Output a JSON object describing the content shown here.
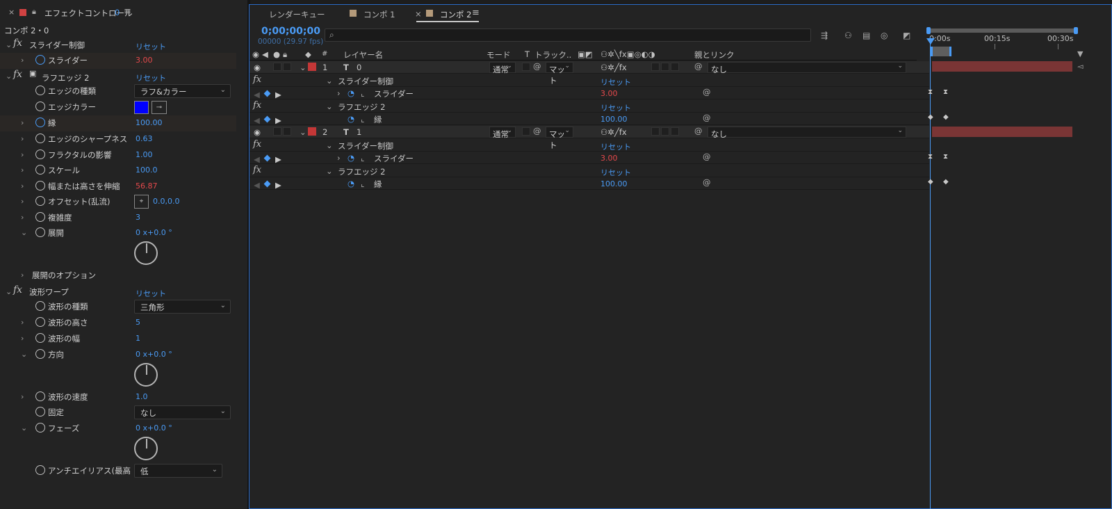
{
  "effect_panel": {
    "close": "×",
    "title": "エフェクトコントロール",
    "title_suffix": "0",
    "menu": "≡",
    "comp_label": "コンポ 2・0",
    "reset": "リセット",
    "slider_control": {
      "name": "スライダー制御",
      "slider_label": "スライダー",
      "slider_value": "3.00"
    },
    "rough_edges": {
      "name": "ラフエッジ 2",
      "edge_type_label": "エッジの種類",
      "edge_type_value": "ラフ&カラー",
      "edge_color_label": "エッジカラー",
      "edge_color": "#0000ff",
      "border_label": "縁",
      "border_value": "100.00",
      "sharpness_label": "エッジのシャープネス",
      "sharpness_value": "0.63",
      "fractal_label": "フラクタルの影響",
      "fractal_value": "1.00",
      "scale_label": "スケール",
      "scale_value": "100.0",
      "stretch_label": "幅または高さを伸縮",
      "stretch_value": "56.87",
      "offset_label": "オフセット(乱流)",
      "offset_value": "0.0,0.0",
      "complexity_label": "複雑度",
      "complexity_value": "3",
      "evolution_label": "展開",
      "evolution_value": "0 x+0.0 °",
      "evolution_options_label": "展開のオプション"
    },
    "wave_warp": {
      "name": "波形ワープ",
      "wave_type_label": "波形の種類",
      "wave_type_value": "三角形",
      "wave_height_label": "波形の高さ",
      "wave_height_value": "5",
      "wave_width_label": "波形の幅",
      "wave_width_value": "1",
      "direction_label": "方向",
      "direction_value": "0 x+0.0 °",
      "wave_speed_label": "波形の速度",
      "wave_speed_value": "1.0",
      "pinning_label": "固定",
      "pinning_value": "なし",
      "phase_label": "フェーズ",
      "phase_value": "0 x+0.0 °",
      "antialias_label": "アンチエイリアス(最高",
      "antialias_value": "低"
    }
  },
  "timeline": {
    "tabs": [
      {
        "label": "レンダーキュー"
      },
      {
        "label": "コンポ 1"
      },
      {
        "label": "コンポ 2"
      }
    ],
    "tab_close": "×",
    "tab_menu": "≡",
    "timecode": "0;00;00;00",
    "frames_fps": "00000 (29.97 fps)",
    "search_placeholder": "",
    "columns": {
      "number": "#",
      "layer_name": "レイヤー名",
      "mode": "モード",
      "t": "T",
      "track_matte": "トラック..",
      "parent_link": "親とリンク"
    },
    "reset": "リセット",
    "layers": [
      {
        "index": "1",
        "name": "0",
        "mode": "通常",
        "matte": "マット",
        "parent": "なし",
        "effects": [
          {
            "name": "スライダー制御",
            "prop": "スライダー",
            "value": "3.00"
          },
          {
            "name": "ラフエッジ 2",
            "prop": "縁",
            "value": "100.00"
          }
        ]
      },
      {
        "index": "2",
        "name": "1",
        "mode": "通常",
        "matte": "マット",
        "parent": "なし",
        "effects": [
          {
            "name": "スライダー制御",
            "prop": "スライダー",
            "value": "3.00"
          },
          {
            "name": "ラフエッジ 2",
            "prop": "縁",
            "value": "100.00"
          }
        ]
      }
    ],
    "ruler": {
      "start": "0:00s",
      "mid": "00:15s",
      "end": "00:30s"
    }
  },
  "colors": {
    "accent": "#4a9bf5",
    "label_red": "#c43737",
    "value_red": "#e5494c",
    "layer_bar": "#7a3535"
  }
}
